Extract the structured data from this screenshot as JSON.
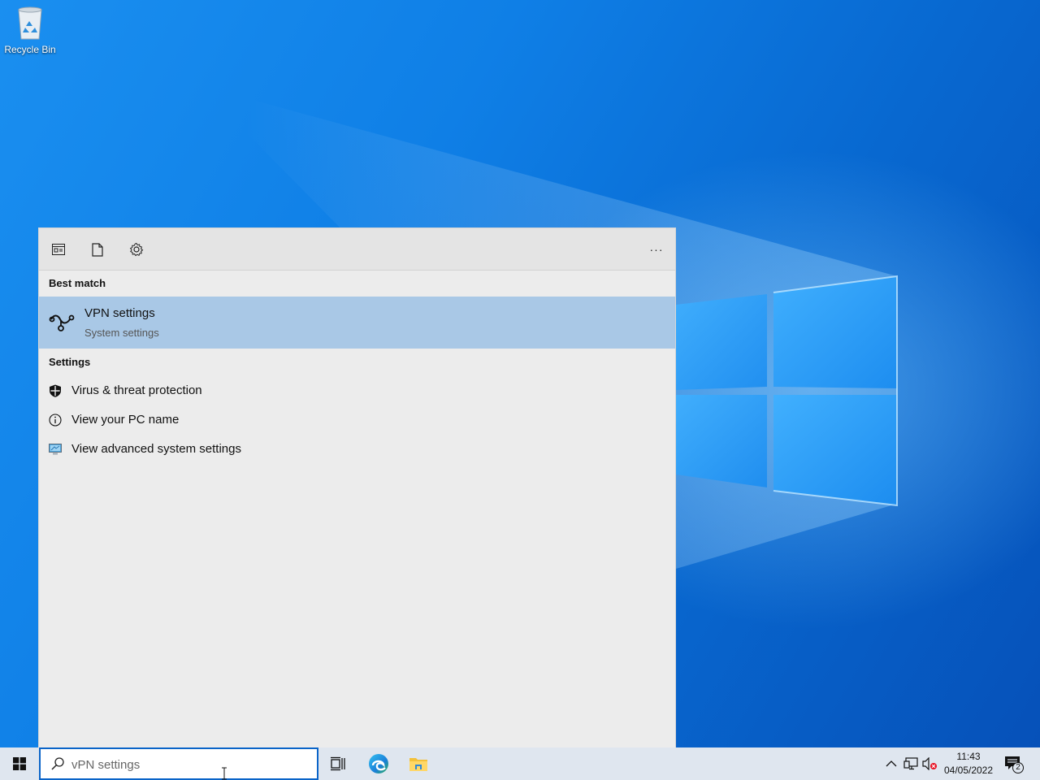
{
  "desktop": {
    "icons": [
      {
        "label": "Recycle Bin",
        "icon": "recycle-bin-icon"
      }
    ]
  },
  "search_panel": {
    "toolbar": {
      "buttons": [
        {
          "icon": "apps-filter-icon"
        },
        {
          "icon": "documents-filter-icon"
        },
        {
          "icon": "settings-filter-icon"
        }
      ],
      "more_label": "···"
    },
    "best_match": {
      "section_title": "Best match",
      "title": "VPN settings",
      "subtitle": "System settings",
      "icon": "vpn-icon"
    },
    "settings": {
      "section_title": "Settings",
      "items": [
        {
          "label": "Virus & threat protection",
          "icon": "shield-icon"
        },
        {
          "label": "View your PC name",
          "icon": "info-icon"
        },
        {
          "label": "View advanced system settings",
          "icon": "system-properties-icon"
        }
      ]
    }
  },
  "taskbar": {
    "search": {
      "value": "vPN settings",
      "icon": "search-icon"
    },
    "apps": [
      {
        "icon": "task-view-icon"
      },
      {
        "icon": "edge-icon"
      },
      {
        "icon": "file-explorer-icon"
      }
    ],
    "tray": {
      "icons": [
        "chevron-up-icon",
        "network-icon",
        "volume-muted-icon"
      ],
      "time": "11:43",
      "date": "04/05/2022",
      "notification_count": "2"
    }
  },
  "colors": {
    "accent": "#0a64c8",
    "best_match_highlight": "#a9c8e6",
    "panel_bg": "#ececec",
    "taskbar_bg": "#dfe6ef"
  }
}
